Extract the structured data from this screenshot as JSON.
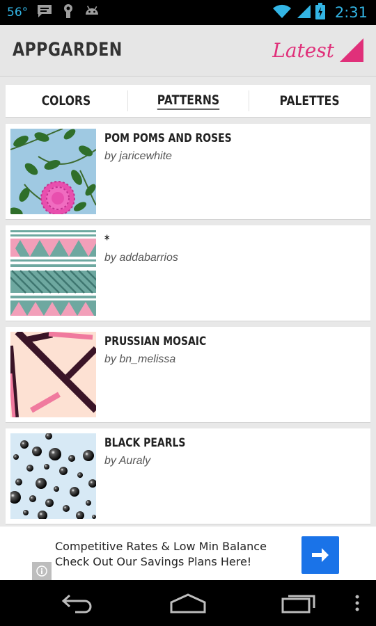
{
  "status_bar": {
    "temperature": "56°",
    "time": "2:31",
    "icons": [
      "message-icon",
      "usb-debug-icon",
      "android-icon",
      "wifi-icon",
      "signal-icon",
      "battery-charging-icon"
    ],
    "color": "#33b5e5"
  },
  "app_bar": {
    "title": "APPGARDEN",
    "sort_label": "Latest",
    "accent_color": "#e0307a"
  },
  "tabs": [
    {
      "label": "COLORS",
      "active": false
    },
    {
      "label": "PATTERNS",
      "active": true
    },
    {
      "label": "PALETTES",
      "active": false
    }
  ],
  "patterns": [
    {
      "title": "POM POMS AND ROSES",
      "author": "by jaricewhite",
      "thumbnail": "floral-pattern-thumbnail"
    },
    {
      "title": "*",
      "author": "by addabarrios",
      "thumbnail": "striped-triangle-pattern-thumbnail"
    },
    {
      "title": "PRUSSIAN MOSAIC",
      "author": "by bn_melissa",
      "thumbnail": "mosaic-pattern-thumbnail"
    },
    {
      "title": "BLACK PEARLS",
      "author": "by Auraly",
      "thumbnail": "pearls-pattern-thumbnail"
    }
  ],
  "ad": {
    "line1": "Competitive Rates & Low Min Balance",
    "line2": "Check Out Our Savings Plans Here!",
    "button_icon": "arrow-right-icon",
    "info_icon": "info-icon",
    "button_color": "#1a73e8"
  },
  "nav_bar": {
    "icons": [
      "back-icon",
      "home-icon",
      "recent-apps-icon",
      "menu-icon"
    ]
  }
}
